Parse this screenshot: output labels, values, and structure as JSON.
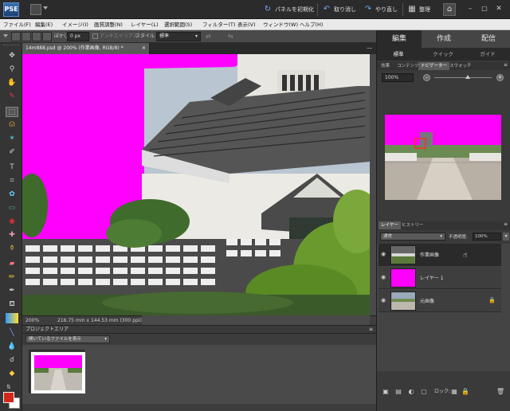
{
  "titlebar": {
    "logo_text": "PSE",
    "reset_panels": "パネルを初期化",
    "undo": "取り消し",
    "redo": "やり直し",
    "organize": "整理"
  },
  "menu": [
    "ファイル(F)",
    "編集(E)",
    "イメージ(I)",
    "画質調整(N)",
    "レイヤー(L)",
    "選択範囲(S)",
    "フィルター(T)",
    "表示(V)",
    "ウィンドウ(W)",
    "ヘルプ(H)"
  ],
  "options": {
    "feather_label": "ぼかし:",
    "feather_value": "0 px",
    "antialias_label": "アンチエイリアス",
    "style_label": "スタイル",
    "style_value": "標準"
  },
  "document": {
    "tab_title": "14m888.psd @ 200% (作業画像, RGB/8) *",
    "zoom": "200%",
    "info": "216.75 mm x 144.53 mm (300 ppi)"
  },
  "project": {
    "title": "プロジェクトエリア",
    "filter": "開いているファイルを表示"
  },
  "panel": {
    "modes": [
      "編集",
      "作成",
      "配信"
    ],
    "submodes": [
      "標準",
      "クイック",
      "ガイド"
    ],
    "top_tabs": [
      "効果",
      "コンテンツ",
      "ナビゲーター",
      "スウォッチ"
    ],
    "nav_zoom": "100%",
    "layer_tabs": [
      "レイヤー",
      "ヒストリー"
    ],
    "blend_mode": "通常",
    "opacity_label": "不透明度:",
    "opacity_value": "100%",
    "layers": [
      {
        "name": "作業画像",
        "selected": true,
        "locked": false
      },
      {
        "name": "レイヤー 1",
        "selected": false,
        "locked": false
      },
      {
        "name": "元画像",
        "selected": false,
        "locked": true
      }
    ],
    "lock_label": "ロック:"
  },
  "colors": {
    "magenta": "#ff00ff",
    "foreground": "#d4261c",
    "background": "#ffffff",
    "accent": "#5b9ef0"
  }
}
